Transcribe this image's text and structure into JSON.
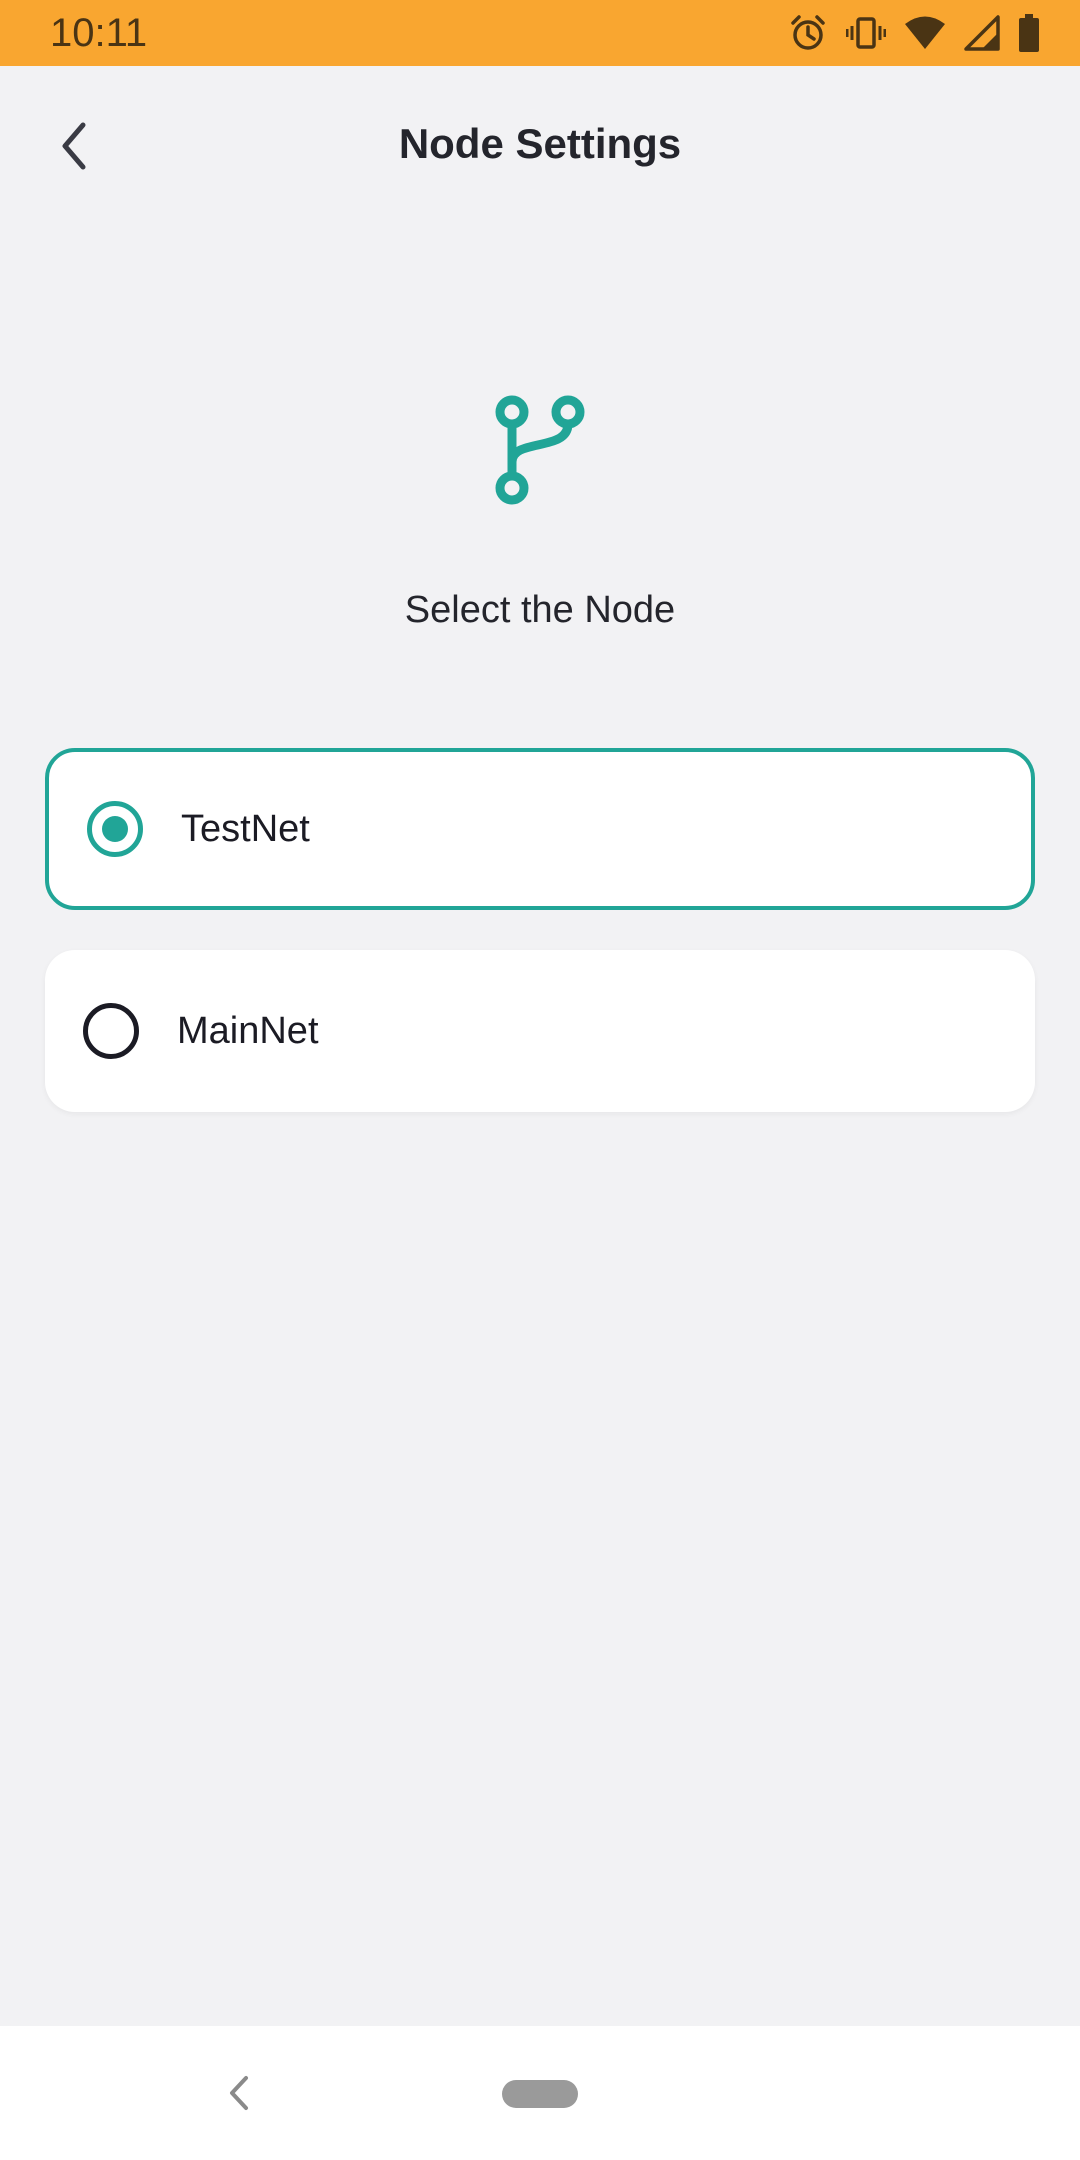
{
  "status_bar": {
    "time": "10:11",
    "icons": [
      "alarm-icon",
      "vibrate-icon",
      "wifi-icon",
      "signal-icon",
      "battery-icon"
    ],
    "background_color": "#f9a630"
  },
  "header": {
    "title": "Node Settings",
    "back_icon": "chevron-left-icon"
  },
  "content": {
    "icon": "git-branch-icon",
    "heading": "Select the Node",
    "accent_color": "#21a597",
    "options": [
      {
        "label": "TestNet",
        "selected": true
      },
      {
        "label": "MainNet",
        "selected": false
      }
    ]
  },
  "nav_bar": {
    "back_icon": "nav-back-icon",
    "home_icon": "home-pill-icon"
  }
}
